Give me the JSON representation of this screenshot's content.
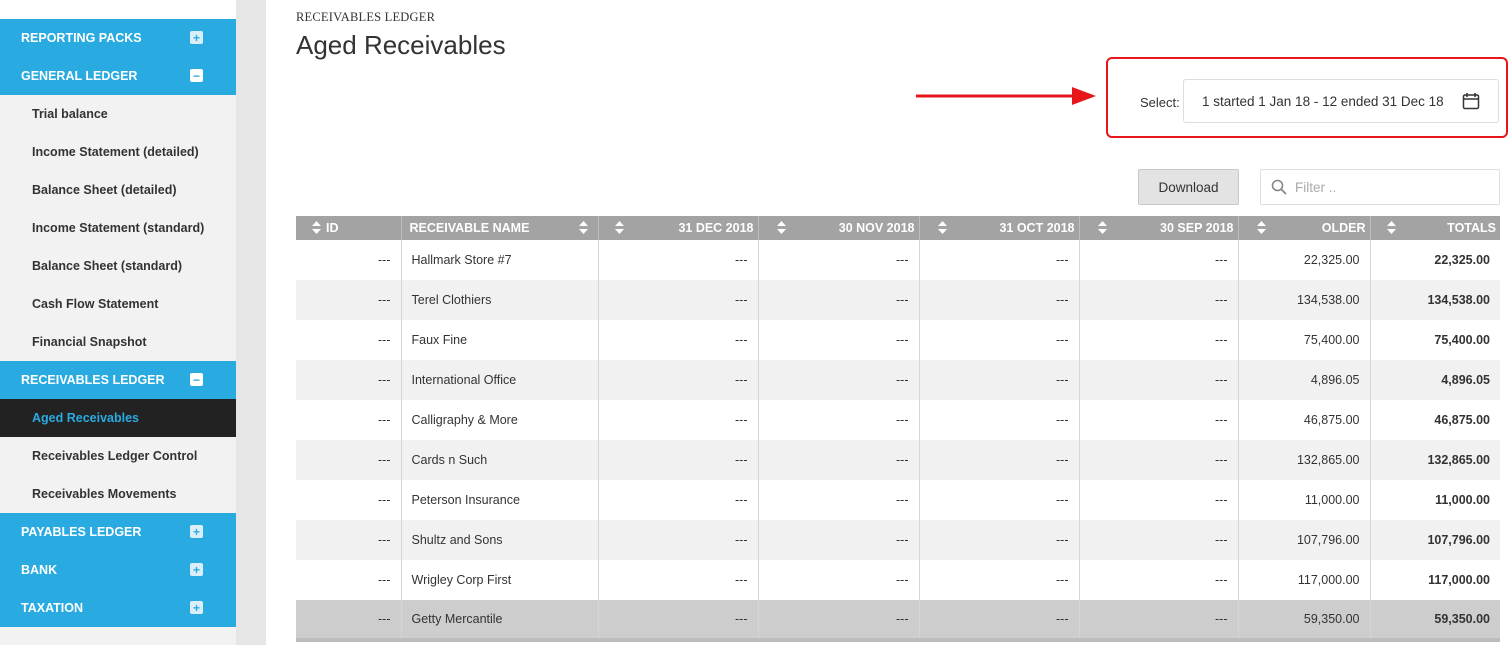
{
  "sidebar": {
    "sections": [
      {
        "label": "REPORTING PACKS",
        "toggle": "+",
        "items": []
      },
      {
        "label": "GENERAL LEDGER",
        "toggle": "−",
        "items": [
          "Trial balance",
          "Income Statement (detailed)",
          "Balance Sheet (detailed)",
          "Income Statement (standard)",
          "Balance Sheet (standard)",
          "Cash Flow Statement",
          "Financial Snapshot"
        ]
      },
      {
        "label": "RECEIVABLES LEDGER",
        "toggle": "−",
        "items": [
          "Aged Receivables",
          "Receivables Ledger Control",
          "Receivables Movements"
        ]
      },
      {
        "label": "PAYABLES LEDGER",
        "toggle": "+",
        "items": []
      },
      {
        "label": "BANK",
        "toggle": "+",
        "items": []
      },
      {
        "label": "TAXATION",
        "toggle": "+",
        "items": []
      }
    ],
    "active_item": "Aged Receivables"
  },
  "header": {
    "breadcrumb": "RECEIVABLES LEDGER",
    "title": "Aged Receivables"
  },
  "period": {
    "label": "Select:",
    "value": "1 started 1 Jan 18 - 12 ended 31 Dec 18"
  },
  "toolbar": {
    "download_label": "Download",
    "filter_placeholder": "Filter .."
  },
  "annotation": {
    "arrow_color": "#e8161b",
    "box_color": "#e8161b"
  },
  "colors": {
    "accent": "#29abe2",
    "active_bg": "#222222",
    "header_bg": "#a3a3a3"
  },
  "table": {
    "columns": [
      "ID",
      "RECEIVABLE NAME",
      "31 DEC 2018",
      "30 NOV 2018",
      "31 OCT 2018",
      "30 SEP 2018",
      "OLDER",
      "TOTALS"
    ],
    "rows": [
      [
        "---",
        "Hallmark Store #7",
        "---",
        "---",
        "---",
        "---",
        "22,325.00",
        "22,325.00"
      ],
      [
        "---",
        "Terel Clothiers",
        "---",
        "---",
        "---",
        "---",
        "134,538.00",
        "134,538.00"
      ],
      [
        "---",
        "Faux Fine",
        "---",
        "---",
        "---",
        "---",
        "75,400.00",
        "75,400.00"
      ],
      [
        "---",
        "International Office",
        "---",
        "---",
        "---",
        "---",
        "4,896.05",
        "4,896.05"
      ],
      [
        "---",
        "Calligraphy & More",
        "---",
        "---",
        "---",
        "---",
        "46,875.00",
        "46,875.00"
      ],
      [
        "---",
        "Cards n Such",
        "---",
        "---",
        "---",
        "---",
        "132,865.00",
        "132,865.00"
      ],
      [
        "---",
        "Peterson Insurance",
        "---",
        "---",
        "---",
        "---",
        "11,000.00",
        "11,000.00"
      ],
      [
        "---",
        "Shultz and Sons",
        "---",
        "---",
        "---",
        "---",
        "107,796.00",
        "107,796.00"
      ],
      [
        "---",
        "Wrigley Corp First",
        "---",
        "---",
        "---",
        "---",
        "117,000.00",
        "117,000.00"
      ],
      [
        "---",
        "Getty Mercantile",
        "---",
        "---",
        "---",
        "---",
        "59,350.00",
        "59,350.00"
      ]
    ],
    "selected_row": 9
  }
}
